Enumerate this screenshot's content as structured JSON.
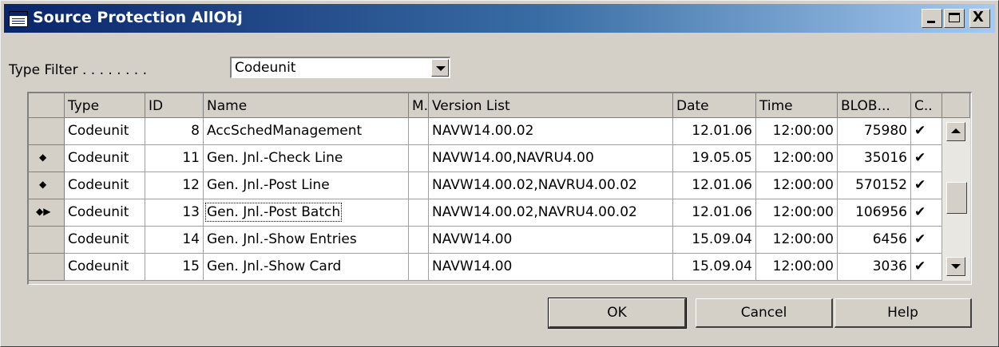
{
  "window": {
    "title": "Source Protection AllObj",
    "icon": "table-window-icon",
    "minimize_glyph": "_",
    "close_glyph": "X"
  },
  "filter": {
    "label": "Type Filter . . . . . . . .",
    "value": "Codeunit"
  },
  "columns": [
    "Type",
    "ID",
    "Name",
    "M.",
    "Version List",
    "Date",
    "Time",
    "BLOB...",
    "C.."
  ],
  "rows": [
    {
      "marker": "",
      "type": "Codeunit",
      "id": "8",
      "name": "AccSchedManagement",
      "m": "",
      "version": "NAVW14.00.02",
      "date": "12.01.06",
      "time": "12:00:00",
      "blob": "75980",
      "c": "✔"
    },
    {
      "marker": "◆",
      "type": "Codeunit",
      "id": "11",
      "name": "Gen. Jnl.-Check Line",
      "m": "",
      "version": "NAVW14.00,NAVRU4.00",
      "date": "19.05.05",
      "time": "12:00:00",
      "blob": "35016",
      "c": "✔"
    },
    {
      "marker": "◆",
      "type": "Codeunit",
      "id": "12",
      "name": "Gen. Jnl.-Post Line",
      "m": "",
      "version": "NAVW14.00.02,NAVRU4.00.02",
      "date": "12.01.06",
      "time": "12:00:00",
      "blob": "570152",
      "c": "✔"
    },
    {
      "marker": "◆▶",
      "type": "Codeunit",
      "id": "13",
      "name": "Gen. Jnl.-Post Batch",
      "m": "",
      "version": "NAVW14.00.02,NAVRU4.00.02",
      "date": "12.01.06",
      "time": "12:00:00",
      "blob": "106956",
      "c": "✔"
    },
    {
      "marker": "",
      "type": "Codeunit",
      "id": "14",
      "name": "Gen. Jnl.-Show Entries",
      "m": "",
      "version": "NAVW14.00",
      "date": "15.09.04",
      "time": "12:00:00",
      "blob": "6456",
      "c": "✔"
    },
    {
      "marker": "",
      "type": "Codeunit",
      "id": "15",
      "name": "Gen. Jnl.-Show Card",
      "m": "",
      "version": "NAVW14.00",
      "date": "15.09.04",
      "time": "12:00:00",
      "blob": "3036",
      "c": "✔"
    }
  ],
  "buttons": {
    "ok": "OK",
    "cancel": "Cancel",
    "help": "Help"
  },
  "colors": {
    "title_start": "#0a246a",
    "title_end": "#a6caf0",
    "face": "#d4d0c8"
  }
}
